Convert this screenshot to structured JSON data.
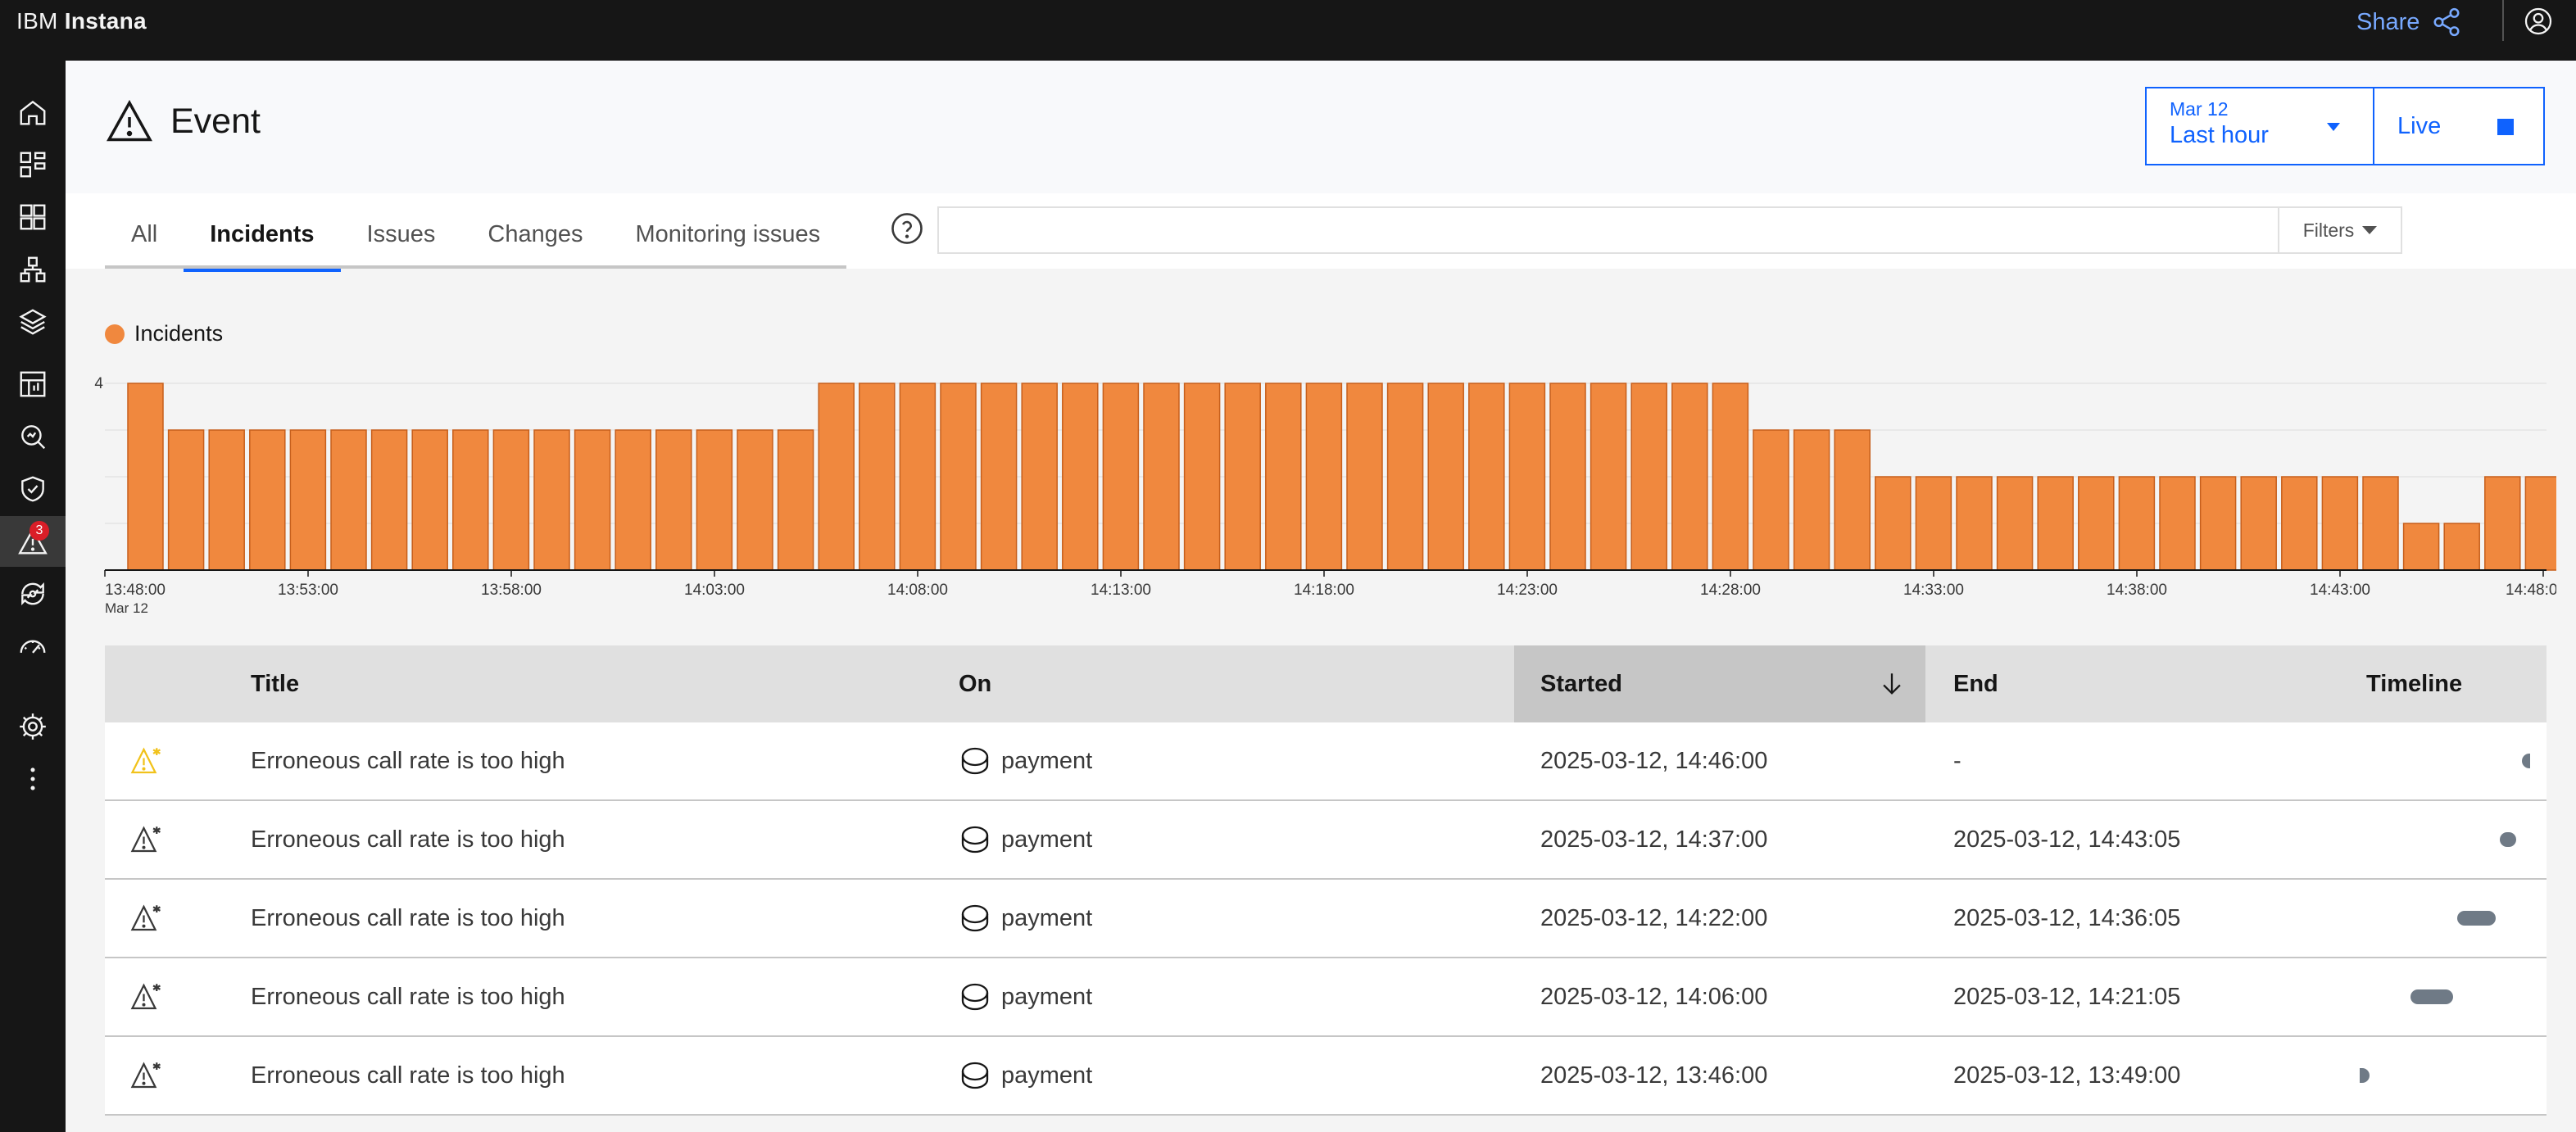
{
  "topbar": {
    "brand_prefix": "IBM",
    "brand_name": "Instana",
    "share_label": "Share"
  },
  "sidenav": {
    "items": [
      "home",
      "applications",
      "infrastructure",
      "platforms",
      "stack",
      "analytics",
      "search",
      "security",
      "events",
      "automation",
      "performance",
      "settings",
      "more"
    ],
    "events_badge": "3"
  },
  "header": {
    "title": "Event",
    "timepicker": {
      "date": "Mar 12",
      "range": "Last hour"
    },
    "live_label": "Live"
  },
  "tabs": [
    {
      "label": "All",
      "active": false
    },
    {
      "label": "Incidents",
      "active": true
    },
    {
      "label": "Issues",
      "active": false
    },
    {
      "label": "Changes",
      "active": false
    },
    {
      "label": "Monitoring issues",
      "active": false
    }
  ],
  "search": {
    "value": "",
    "placeholder": ""
  },
  "filters_label": "Filters",
  "colors": {
    "accent": "#0f62fe",
    "bar": "#f0883e",
    "bar_stroke": "#c65f1c",
    "badge": "#da1e28"
  },
  "chart_data": {
    "type": "bar",
    "legend": [
      "Incidents"
    ],
    "ylim": [
      0,
      4
    ],
    "y_tick_labels": [
      "4"
    ],
    "x_tick_labels": [
      "13:48:00",
      "13:53:00",
      "13:58:00",
      "14:03:00",
      "14:08:00",
      "14:13:00",
      "14:18:00",
      "14:23:00",
      "14:28:00",
      "14:33:00",
      "14:38:00",
      "14:43:00",
      "14:48:00"
    ],
    "x_sublabel": "Mar 12",
    "series": [
      {
        "values": [
          4,
          3,
          3,
          3,
          3,
          3,
          3,
          3,
          3,
          3,
          3,
          3,
          3,
          3,
          3,
          3,
          3,
          4,
          4,
          4,
          4,
          4,
          4,
          4,
          4,
          4,
          4,
          4,
          4,
          4,
          4,
          4,
          4,
          4,
          4,
          4,
          4,
          4,
          4,
          4,
          3,
          3,
          3,
          2,
          2,
          2,
          2,
          2,
          2,
          2,
          2,
          2,
          2,
          2,
          2,
          2,
          1,
          1,
          2,
          2
        ]
      }
    ]
  },
  "table": {
    "columns": {
      "title": "Title",
      "on": "On",
      "started": "Started",
      "end": "End",
      "timeline": "Timeline"
    },
    "rows": [
      {
        "severity": "warning",
        "title": "Erroneous call rate is too high",
        "on": "payment",
        "started": "2025-03-12, 14:46:00",
        "end": "-",
        "timeline": {
          "start": 0.97,
          "end": 1.0
        }
      },
      {
        "severity": "ended",
        "title": "Erroneous call rate is too high",
        "on": "payment",
        "started": "2025-03-12, 14:37:00",
        "end": "2025-03-12, 14:43:05",
        "timeline": {
          "start": 0.82,
          "end": 0.92
        }
      },
      {
        "severity": "ended",
        "title": "Erroneous call rate is too high",
        "on": "payment",
        "started": "2025-03-12, 14:22:00",
        "end": "2025-03-12, 14:36:05",
        "timeline": {
          "start": 0.57,
          "end": 0.8
        }
      },
      {
        "severity": "ended",
        "title": "Erroneous call rate is too high",
        "on": "payment",
        "started": "2025-03-12, 14:06:00",
        "end": "2025-03-12, 14:21:05",
        "timeline": {
          "start": 0.3,
          "end": 0.55
        }
      },
      {
        "severity": "ended",
        "title": "Erroneous call rate is too high",
        "on": "payment",
        "started": "2025-03-12, 13:46:00",
        "end": "2025-03-12, 13:49:00",
        "timeline": {
          "start": 0.0,
          "end": 0.02
        }
      }
    ]
  }
}
